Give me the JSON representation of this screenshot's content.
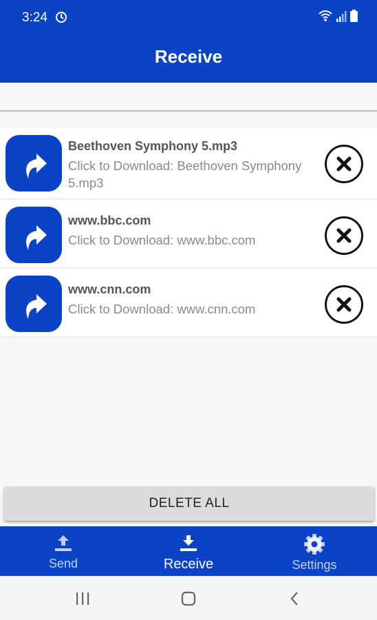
{
  "status": {
    "time": "3:24"
  },
  "header": {
    "title": "Receive"
  },
  "items": [
    {
      "title": "Beethoven Symphony 5.mp3",
      "subtitle": "Click to Download: Beethoven Symphony 5.mp3"
    },
    {
      "title": "www.bbc.com",
      "subtitle": "Click to Download: www.bbc.com"
    },
    {
      "title": "www.cnn.com",
      "subtitle": "Click to Download: www.cnn.com"
    }
  ],
  "actions": {
    "delete_all": "DELETE ALL"
  },
  "nav": {
    "send": "Send",
    "receive": "Receive",
    "settings": "Settings",
    "selected": "receive"
  },
  "icons": {
    "item": "share-arrow-icon",
    "remove": "close-icon",
    "send": "upload-icon",
    "receive": "download-icon",
    "settings": "gear-icon"
  },
  "colors": {
    "primary": "#0a43c6"
  }
}
